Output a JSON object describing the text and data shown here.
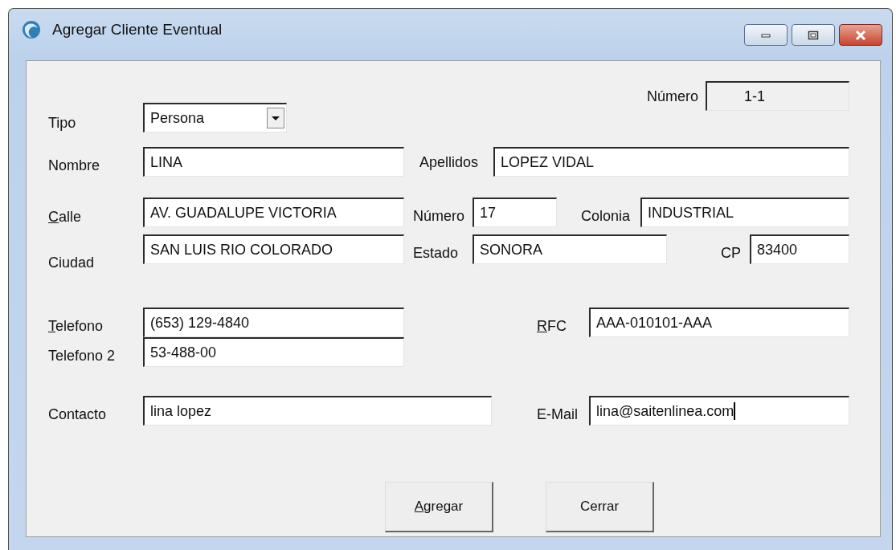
{
  "window": {
    "title": "Agregar Cliente Eventual"
  },
  "form": {
    "numero": {
      "label": "Número",
      "value": "1-1",
      "disabled": true
    },
    "tipo": {
      "label": "Tipo",
      "value": "Persona",
      "kind": "combo"
    },
    "nombre": {
      "label": "Nombre",
      "value": "LINA"
    },
    "apellidos": {
      "label": "Apellidos",
      "value": "LOPEZ VIDAL"
    },
    "calle": {
      "label": "Calle",
      "value": "AV. GUADALUPE VICTORIA",
      "mnemonic": true
    },
    "numero_calle": {
      "label": "Número",
      "value": "17"
    },
    "colonia": {
      "label": "Colonia",
      "value": "INDUSTRIAL"
    },
    "ciudad": {
      "label": "Ciudad",
      "value": "SAN LUIS RIO COLORADO"
    },
    "estado": {
      "label": "Estado",
      "value": "SONORA"
    },
    "cp": {
      "label": "CP",
      "value": "83400"
    },
    "telefono": {
      "label": "Telefono",
      "value": "(653) 129-4840",
      "mnemonic": true
    },
    "rfc": {
      "label": "RFC",
      "value": "AAA-010101-AAA",
      "mnemonic": true
    },
    "telefono_2": {
      "label": "Telefono 2",
      "value": "53-488-00"
    },
    "contacto": {
      "label": "Contacto",
      "value": "lina lopez"
    },
    "email": {
      "label": "E-Mail",
      "value": "lina@saitenlinea.com",
      "focused": true
    }
  },
  "buttons": [
    {
      "label": "Agregar",
      "mnemonic": true
    },
    {
      "label": "Cerrar",
      "mnemonic": false
    }
  ]
}
